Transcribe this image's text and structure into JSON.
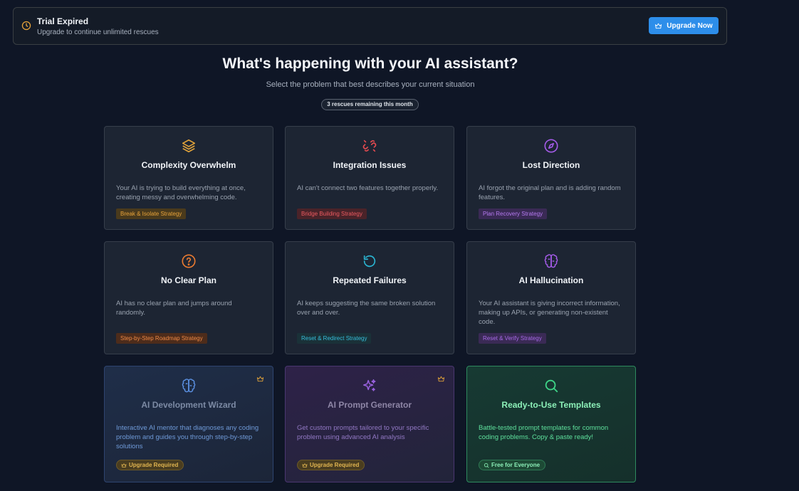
{
  "banner": {
    "title": "Trial Expired",
    "subtitle": "Upgrade to continue unlimited rescues",
    "button_label": "Upgrade Now"
  },
  "header": {
    "title": "What's happening with your AI assistant?",
    "subtitle": "Select the problem that best describes your current situation",
    "remaining": "3 rescues remaining this month"
  },
  "problems": [
    {
      "icon": "layers-icon",
      "title": "Complexity Overwhelm",
      "description": "Your AI is trying to build everything at once, creating messy and overwhelming code.",
      "strategy": "Break & Isolate Strategy",
      "color": "#e0a23a"
    },
    {
      "icon": "broken-link-icon",
      "title": "Integration Issues",
      "description": "AI can't connect two features together properly.",
      "strategy": "Bridge Building Strategy",
      "color": "#e04a50"
    },
    {
      "icon": "compass-icon",
      "title": "Lost Direction",
      "description": "AI forgot the original plan and is adding random features.",
      "strategy": "Plan Recovery Strategy",
      "color": "#a45be8"
    },
    {
      "icon": "question-circle-icon",
      "title": "No Clear Plan",
      "description": "AI has no clear plan and jumps around randomly.",
      "strategy": "Step-by-Step Roadmap Strategy",
      "color": "#ea7a30"
    },
    {
      "icon": "rotate-icon",
      "title": "Repeated Failures",
      "description": "AI keeps suggesting the same broken solution over and over.",
      "strategy": "Reset & Redirect Strategy",
      "color": "#2ab3d0"
    },
    {
      "icon": "brain-icon",
      "title": "AI Hallucination",
      "description": "Your AI assistant is giving incorrect information, making up APIs, or generating non-existent code.",
      "strategy": "Reset & Verify Strategy",
      "color": "#a45be8"
    }
  ],
  "tools": [
    {
      "icon": "brain-icon",
      "title": "AI Development Wizard",
      "description": "Interactive AI mentor that diagnoses any coding problem and guides you through step-by-step solutions",
      "badge": "Upgrade Required",
      "badge_icon": "crown-icon"
    },
    {
      "icon": "sparkles-icon",
      "title": "AI Prompt Generator",
      "description": "Get custom prompts tailored to your specific problem using advanced AI analysis",
      "badge": "Upgrade Required",
      "badge_icon": "crown-icon"
    },
    {
      "icon": "search-icon",
      "title": "Ready-to-Use Templates",
      "description": "Battle-tested prompt templates for common coding problems. Copy & paste ready!",
      "badge": "Free for Everyone",
      "badge_icon": "search-icon"
    }
  ]
}
